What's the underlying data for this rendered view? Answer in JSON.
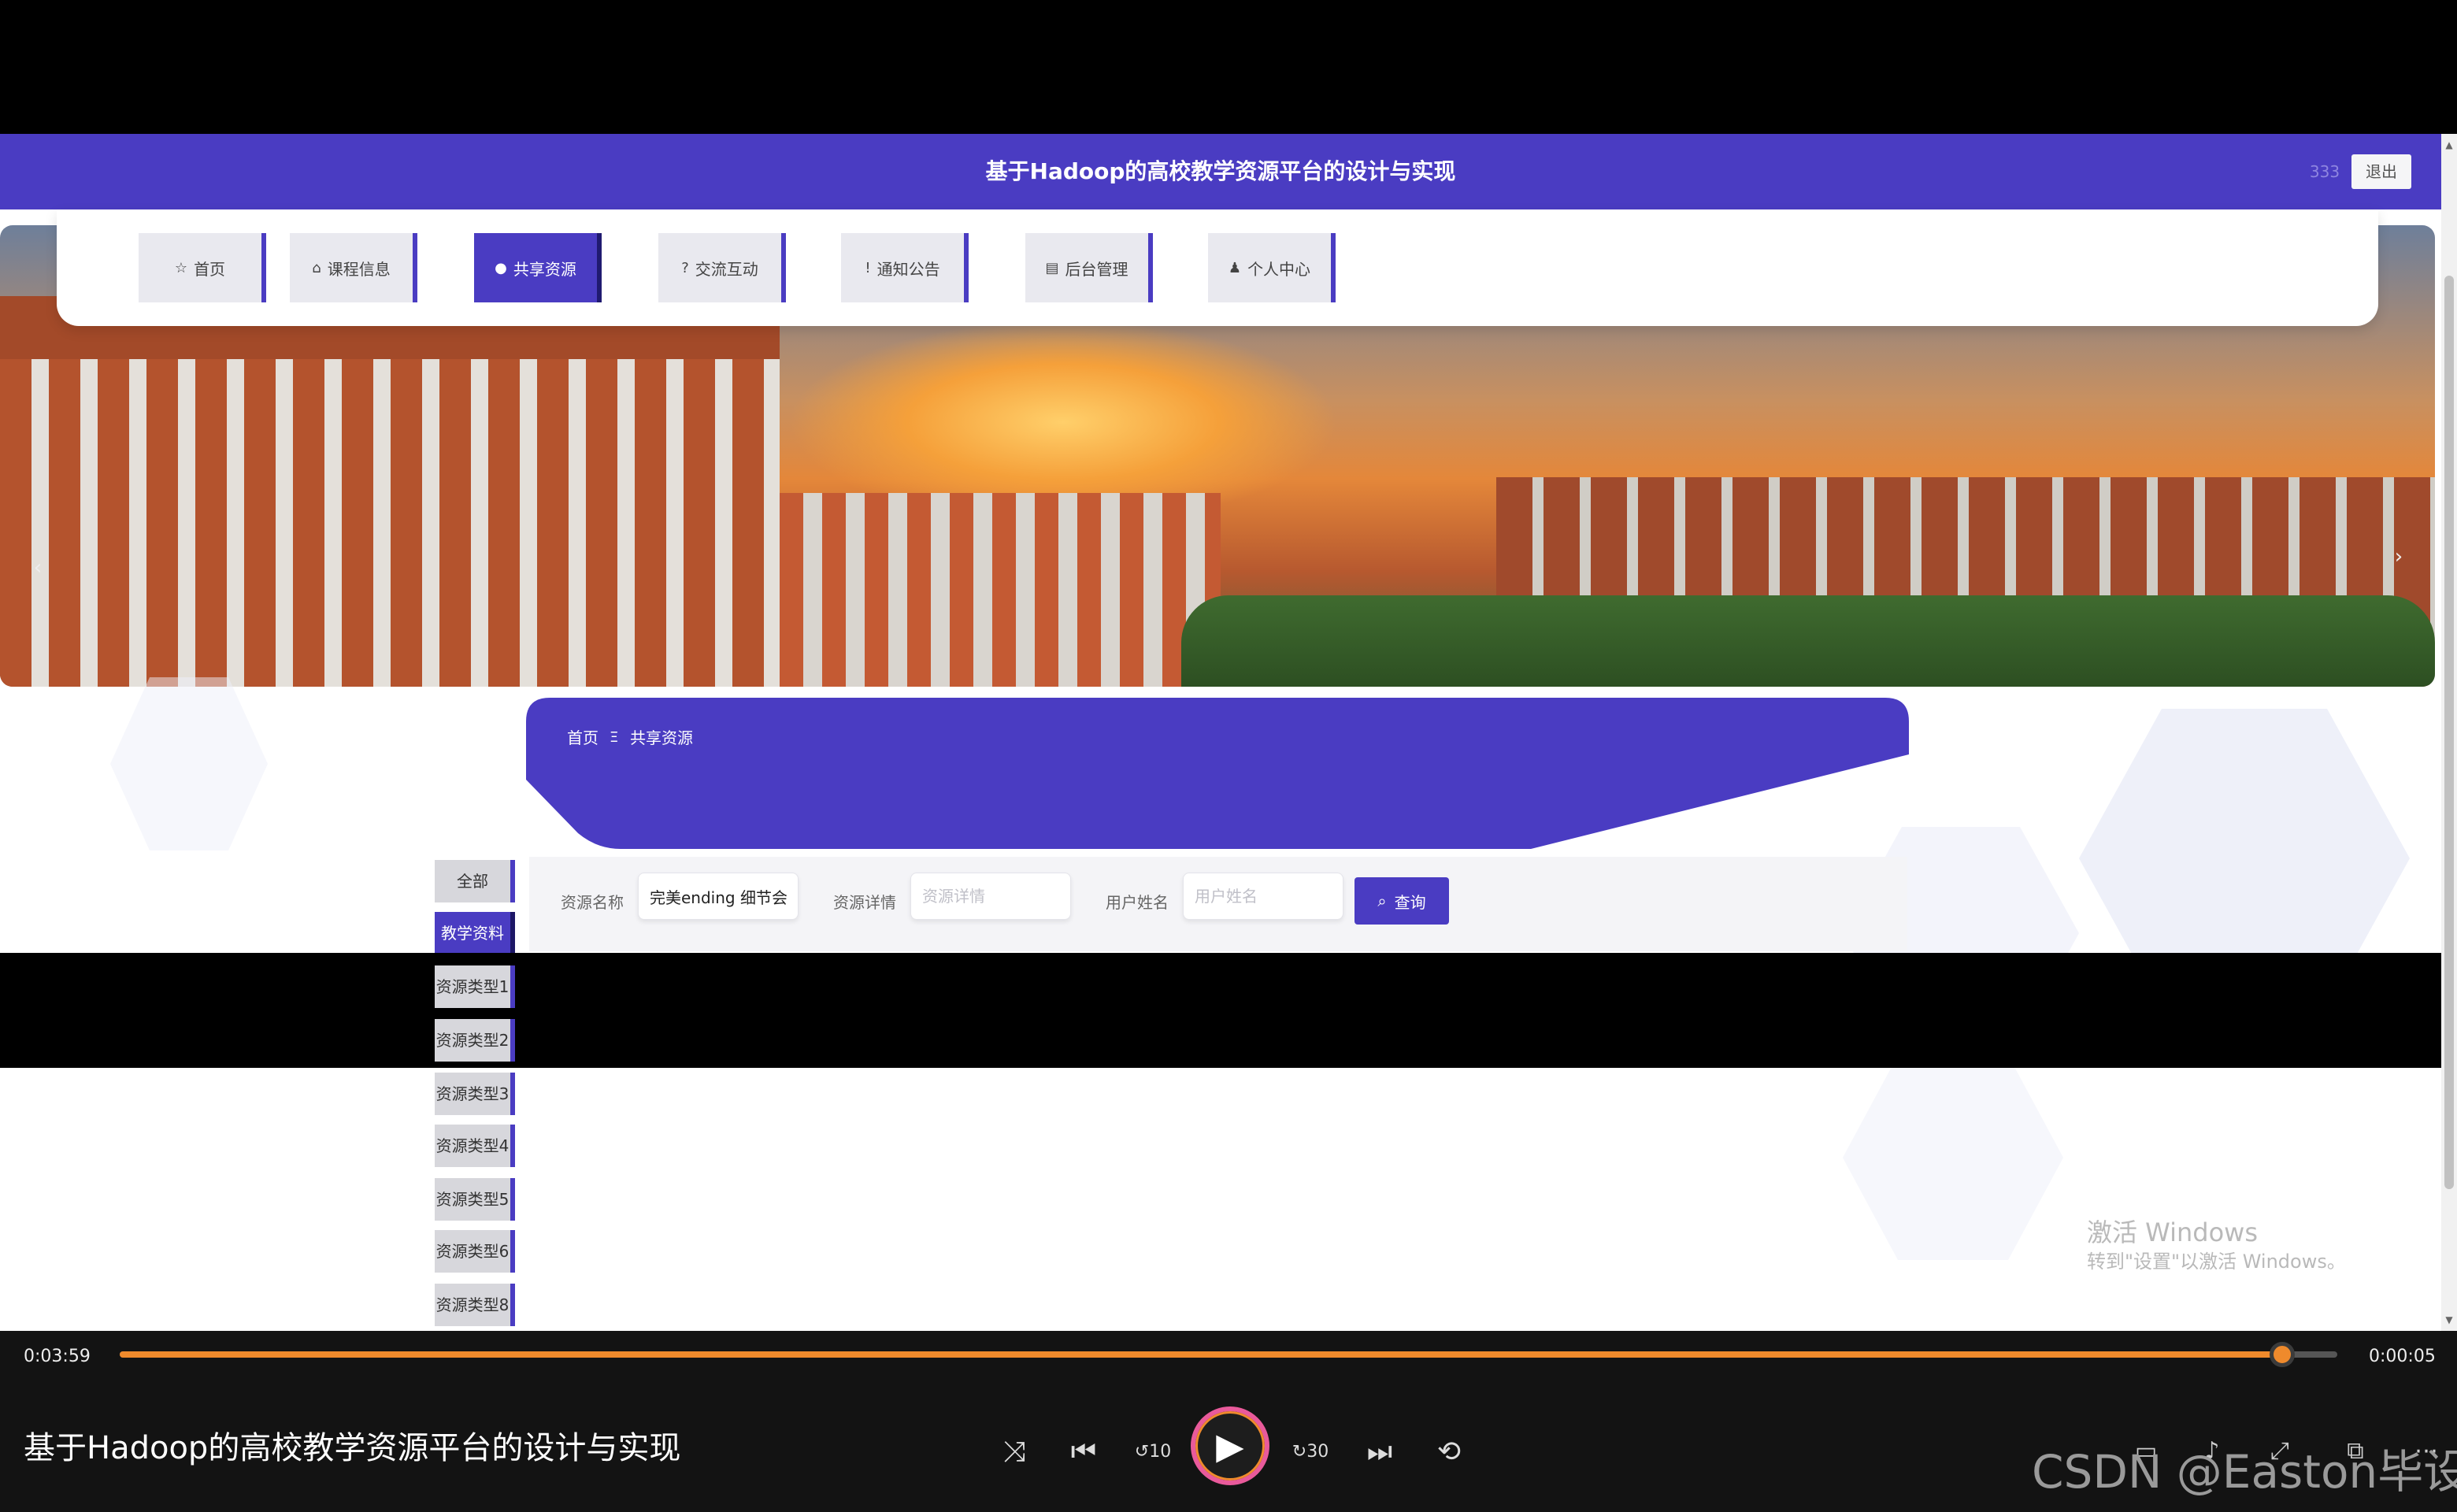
{
  "header": {
    "title": "基于Hadoop的高校教学资源平台的设计与实现",
    "user_num": "333",
    "logout_label": "退出"
  },
  "nav": [
    {
      "icon": "☆",
      "label": "首页"
    },
    {
      "icon": "⌂",
      "label": "课程信息"
    },
    {
      "icon": "●",
      "label": "共享资源"
    },
    {
      "icon": "?",
      "label": "交流互动"
    },
    {
      "icon": "!",
      "label": "通知公告"
    },
    {
      "icon": "▤",
      "label": "后台管理"
    },
    {
      "icon": "♟",
      "label": "个人中心"
    }
  ],
  "banner": {
    "prev": "‹",
    "next": "›"
  },
  "breadcrumb": {
    "home": "首页",
    "sep": "Ξ",
    "current": "共享资源"
  },
  "categories": [
    "全部",
    "教学资料",
    "资源类型1",
    "资源类型2",
    "资源类型3",
    "资源类型4",
    "资源类型5",
    "资源类型6",
    "资源类型8"
  ],
  "search": {
    "name_label": "资源名称",
    "name_value": "完美ending 细节会",
    "detail_label": "资源详情",
    "detail_placeholder": "资源详情",
    "user_label": "用户姓名",
    "user_placeholder": "用户姓名",
    "button_label": "查询"
  },
  "windows_watermark": {
    "line1": "激活 Windows",
    "line2": "转到\"设置\"以激活 Windows。"
  },
  "player": {
    "time_current": "0:03:59",
    "time_total": "0:00:05",
    "progress": 0.975,
    "title": "基于Hadoop的高校教学资源平台的设计与实现",
    "rewind_label": "10",
    "forward_label": "30"
  },
  "watermark": "CSDN @Easton毕设",
  "colors": {
    "brand": "#4a3cc2",
    "accent": "#ef8a2c"
  }
}
